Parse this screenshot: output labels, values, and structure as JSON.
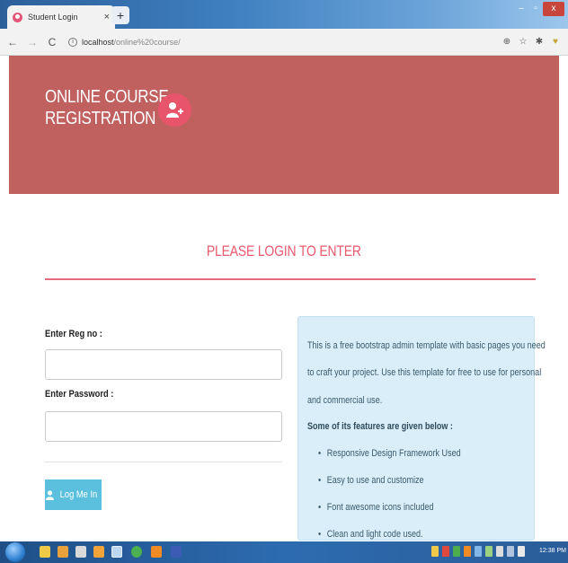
{
  "browser": {
    "tab_title": "Student Login",
    "tab_close": "×",
    "new_tab": "+",
    "window_min": "–",
    "window_max": "▫",
    "window_close": "x",
    "nav_back": "←",
    "nav_forward": "→",
    "nav_reload": "C",
    "url_host": "localhost",
    "url_path": "/online%20course/",
    "info_icon": "i",
    "zoom_icon": "⊕",
    "star_icon": "☆",
    "pin_icon": "✱",
    "ext_icon": "♥"
  },
  "header": {
    "brand_line1": "ONLINE COURSE",
    "brand_line2": "REGISTRATION",
    "badge_icon": "user-plus-icon",
    "banner_color": "#c1615f",
    "badge_color": "#e8546a"
  },
  "login": {
    "heading": "PLEASE LOGIN TO ENTER",
    "reg_label": "Enter Reg no :",
    "reg_value": "",
    "password_label": "Enter Password :",
    "password_value": "",
    "button_label": "Log Me In",
    "button_color": "#5bc0de"
  },
  "panel": {
    "line1": "This is a free bootstrap admin template with basic pages you need",
    "line2": "to craft your project. Use this template for free to use for personal",
    "line3": "and commercial use.",
    "features_heading": "Some of its features are given below :",
    "features": [
      "Responsive Design Framework Used",
      "Easy to use and customize",
      "Font awesome icons included",
      "Clean and light code used."
    ]
  },
  "taskbar": {
    "clock": "12:38 PM"
  }
}
